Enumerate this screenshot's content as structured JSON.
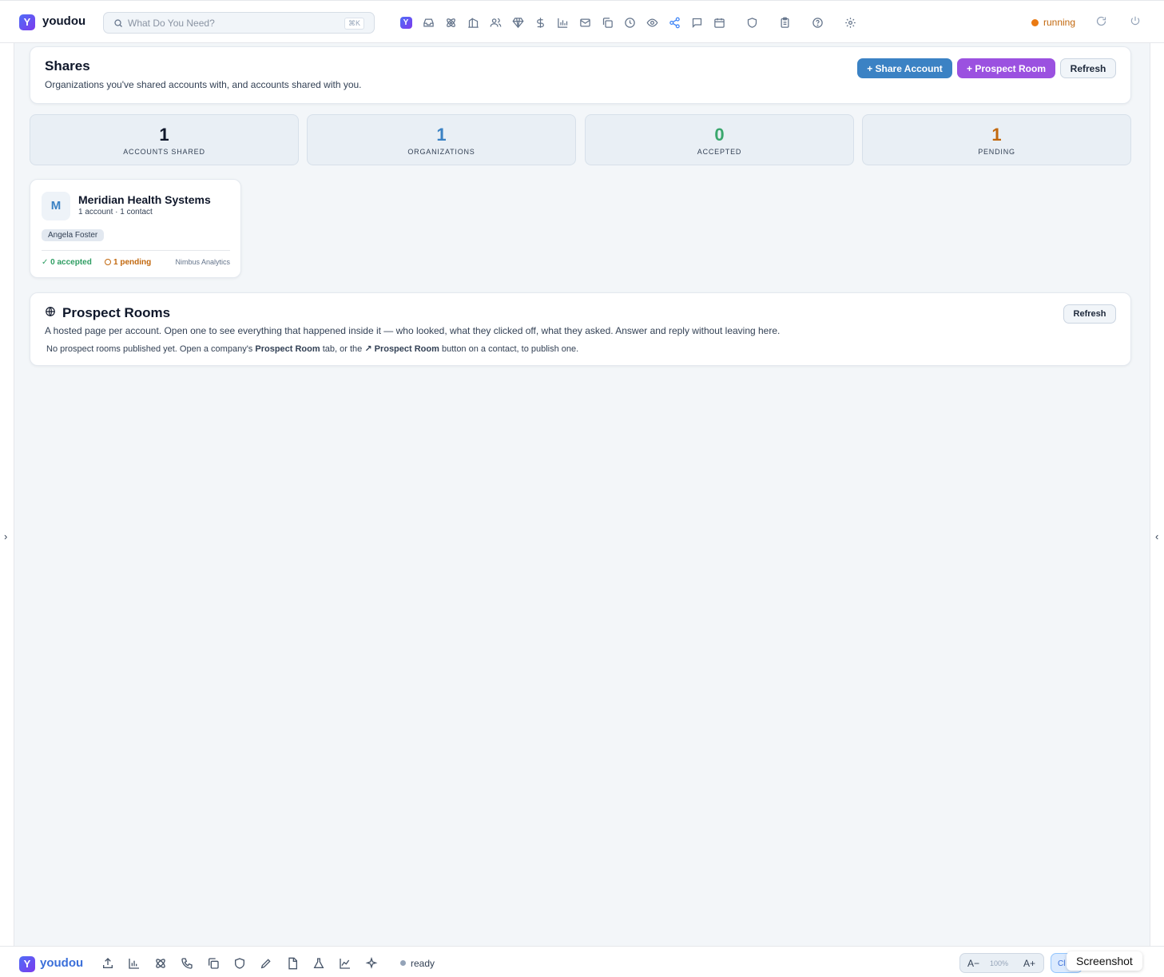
{
  "topbar": {
    "brand": "youdou",
    "logo_letter": "Y",
    "search_placeholder": "What Do You Need?",
    "search_shortcut": "⌘K",
    "status": "running",
    "nav_icons": [
      "youdou-logo",
      "inbox",
      "atom",
      "buildings",
      "people",
      "gem",
      "dollar",
      "bar-chart",
      "mail",
      "copy",
      "clock",
      "eye",
      "share",
      "chat",
      "calendar",
      "shield",
      "clipboard",
      "help",
      "settings"
    ]
  },
  "shares": {
    "title": "Shares",
    "subtitle": "Organizations you've shared accounts with, and accounts shared with you.",
    "share_account_label": "+ Share Account",
    "prospect_room_label": "+ Prospect Room",
    "refresh_label": "Refresh"
  },
  "stats": [
    {
      "value": "1",
      "label": "ACCOUNTS SHARED",
      "color": "#0f172a"
    },
    {
      "value": "1",
      "label": "ORGANIZATIONS",
      "color": "#3b82c4"
    },
    {
      "value": "0",
      "label": "ACCEPTED",
      "color": "#3aa76d"
    },
    {
      "value": "1",
      "label": "PENDING",
      "color": "#c2680e"
    }
  ],
  "org_card": {
    "avatar_letter": "M",
    "name": "Meridian Health Systems",
    "meta": "1 account · 1 contact",
    "contact_chip": "Angela Foster",
    "accepted": "✓ 0 accepted",
    "pending": "1 pending",
    "shared_by": "Nimbus Analytics"
  },
  "prospect_rooms": {
    "title": "Prospect Rooms",
    "description": "A hosted page per account. Open one to see everything that happened inside it — who looked, what they clicked off, what they asked. Answer and reply without leaving here.",
    "empty_prefix": "No prospect rooms published yet. Open a company's",
    "empty_tab": "Prospect Room",
    "empty_middle": "tab, or the",
    "empty_button": "↗ Prospect Room",
    "empty_suffix": "button on a contact, to publish one.",
    "refresh_label": "Refresh"
  },
  "rails": {
    "left_arrow": "›",
    "right_arrow": "‹"
  },
  "bottombar": {
    "brand": "youdou",
    "logo_letter": "Y",
    "status": "ready",
    "zoom_out": "A−",
    "zoom_level": "100%",
    "zoom_in": "A+",
    "cl_label": "Cl",
    "tooltip": "Screenshot"
  }
}
